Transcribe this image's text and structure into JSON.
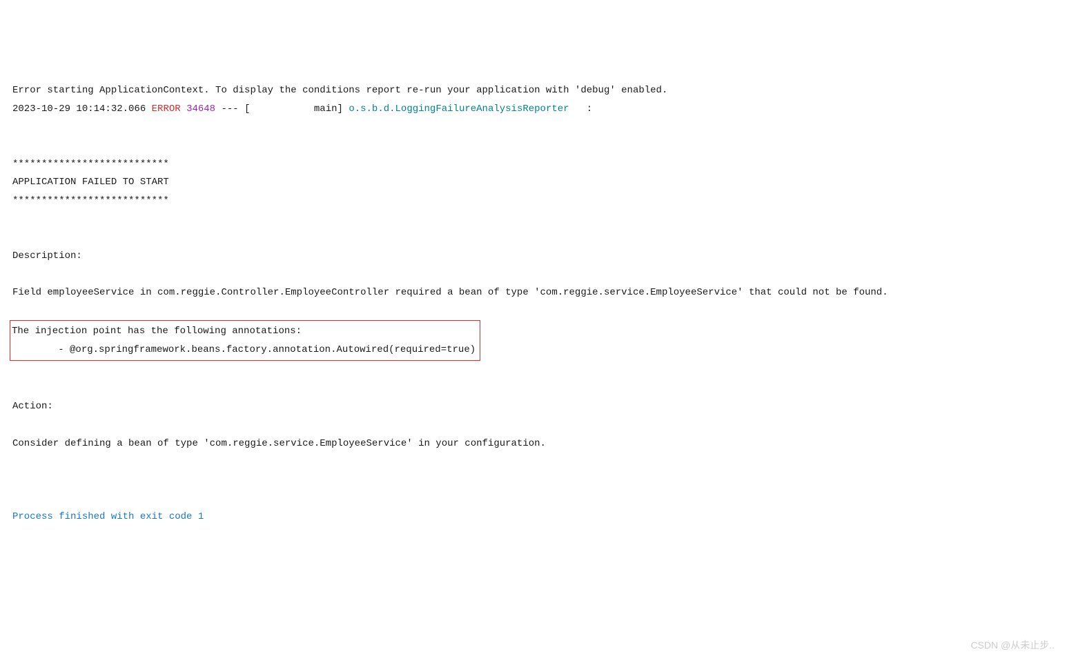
{
  "log": {
    "line1": "Error starting ApplicationContext. To display the conditions report re-run your application with 'debug' enabled.",
    "timestamp": "2023-10-29 10:14:32.066",
    "level": "ERROR",
    "pid": "34648",
    "separator": " --- [           main] ",
    "logger": "o.s.b.d.LoggingFailureAnalysisReporter",
    "colon": "   :",
    "divider": "***************************",
    "failHeader": "APPLICATION FAILED TO START",
    "descLabel": "Description:",
    "descText": "Field employeeService in com.reggie.Controller.EmployeeController required a bean of type 'com.reggie.service.EmployeeService' that could not be found.",
    "injLine1": "The injection point has the following annotations:",
    "injLine2": "\t- @org.springframework.beans.factory.annotation.Autowired(required=true)",
    "actionLabel": "Action:",
    "actionText": "Consider defining a bean of type 'com.reggie.service.EmployeeService' in your configuration.",
    "exitText": "Process finished with exit code 1"
  },
  "watermark": "CSDN @从未止步.."
}
